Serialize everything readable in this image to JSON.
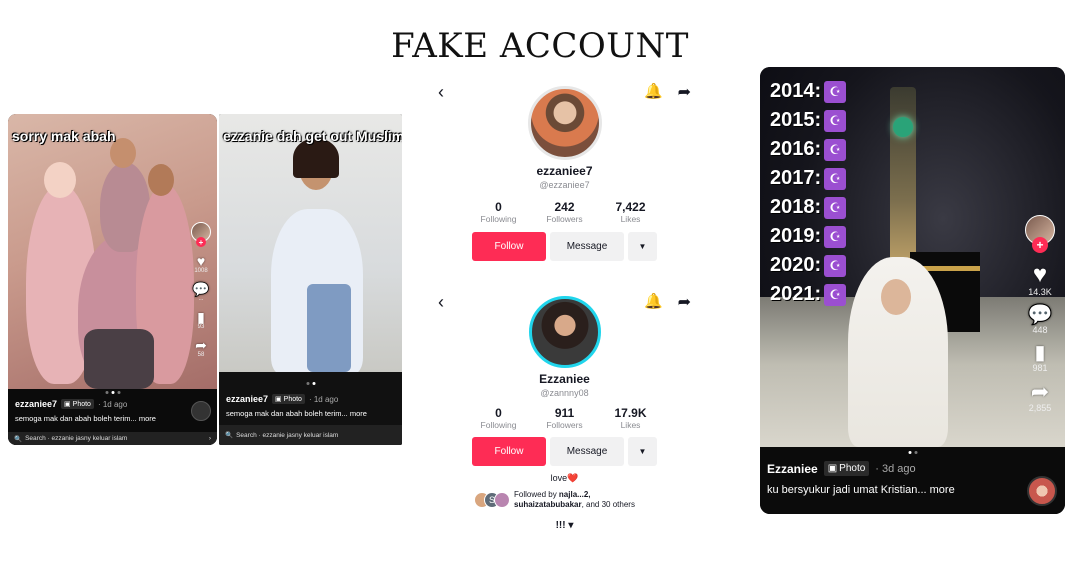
{
  "title": "FAKE ACCOUNT",
  "post1": {
    "overlay": "sorry mak abah",
    "username": "ezzaniee7",
    "badge": "Photo",
    "ago": "· 1d ago",
    "desc": "semoga mak dan abah boleh terim... more",
    "search": "Search · ezzanie jasny keluar islam",
    "likes": "1008",
    "comments": "...",
    "saves": "93",
    "shares": "58"
  },
  "post2": {
    "overlay": "ezzanie dah get out Muslim",
    "username": "ezzaniee7",
    "badge": "Photo",
    "ago": "· 1d ago",
    "desc": "semoga mak dan abah boleh terim... more",
    "search": "Search · ezzanie jasny keluar islam"
  },
  "profile1": {
    "name": "ezzaniee7",
    "handle": "@ezzaniee7",
    "stats": [
      {
        "n": "0",
        "l": "Following"
      },
      {
        "n": "242",
        "l": "Followers"
      },
      {
        "n": "7,422",
        "l": "Likes"
      }
    ],
    "follow": "Follow",
    "message": "Message",
    "more": "▼"
  },
  "profile2": {
    "name": "Ezzaniee",
    "handle": "@zannny08",
    "stats": [
      {
        "n": "0",
        "l": "Following"
      },
      {
        "n": "911",
        "l": "Followers"
      },
      {
        "n": "17.9K",
        "l": "Likes"
      }
    ],
    "follow": "Follow",
    "message": "Message",
    "more": "▼",
    "bio": "love❤️",
    "followed_prefix": "Followed by ",
    "followed_names": "najla...2,",
    "followed_line2_name": "suhaizatabubakar",
    "followed_suffix": ", and 30 others",
    "mini_letter": "S",
    "exclaim": "!!! ▾"
  },
  "post3": {
    "years": [
      "2014:",
      "2015:",
      "2016:",
      "2017:",
      "2018:",
      "2019:",
      "2020:",
      "2021:"
    ],
    "moon": "☪",
    "username": "Ezzaniee",
    "badge": "Photo",
    "ago": "· 3d ago",
    "desc": "ku bersyukur jadi umat Kristian... more",
    "likes": "14.3K",
    "comments": "448",
    "saves": "981",
    "shares": "2,855"
  },
  "colors": {
    "tiktok_red": "#fe2c55",
    "ring_cyan": "#20d5ec",
    "moon_purple": "#9b4fd1"
  }
}
